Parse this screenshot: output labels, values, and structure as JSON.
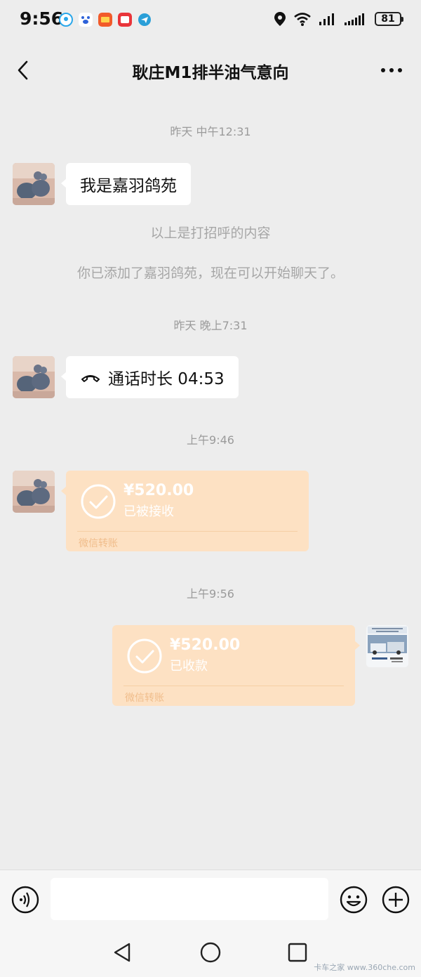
{
  "status_bar": {
    "time": "9:56",
    "battery": "81",
    "notification_icons": [
      "qq-icon",
      "baidu-icon",
      "app-icon",
      "app-icon-red",
      "telegram-icon"
    ]
  },
  "header": {
    "title": "耿庄M1排半油气意向",
    "back_icon": "chevron-left-icon",
    "more_icon": "more-dots-icon"
  },
  "messages": {
    "ts1": "昨天 中午12:31",
    "greeting": "我是嘉羽鸽苑",
    "sys1": "以上是打招呼的内容",
    "sys2": "你已添加了嘉羽鸽苑，现在可以开始聊天了。",
    "ts2": "昨天 晚上7:31",
    "call_text": "通话时长 04:53",
    "ts3": "上午9:46",
    "transfer1": {
      "amount": "¥520.00",
      "status": "已被接收",
      "label": "微信转账"
    },
    "ts4": "上午9:56",
    "transfer2": {
      "amount": "¥520.00",
      "status": "已收款",
      "label": "微信转账"
    }
  },
  "input_bar": {
    "voice_icon": "voice-icon",
    "emoji_icon": "emoji-icon",
    "plus_icon": "plus-icon",
    "placeholder": ""
  },
  "nav_bar": {
    "back_icon": "triangle-back-icon",
    "home_icon": "circle-home-icon",
    "recent_icon": "square-recent-icon"
  },
  "watermark": "卡车之家 www.360che.com",
  "colors": {
    "background": "#ededed",
    "transfer_bubble": "#fde1c3",
    "timestamp": "#9b9b9b"
  }
}
